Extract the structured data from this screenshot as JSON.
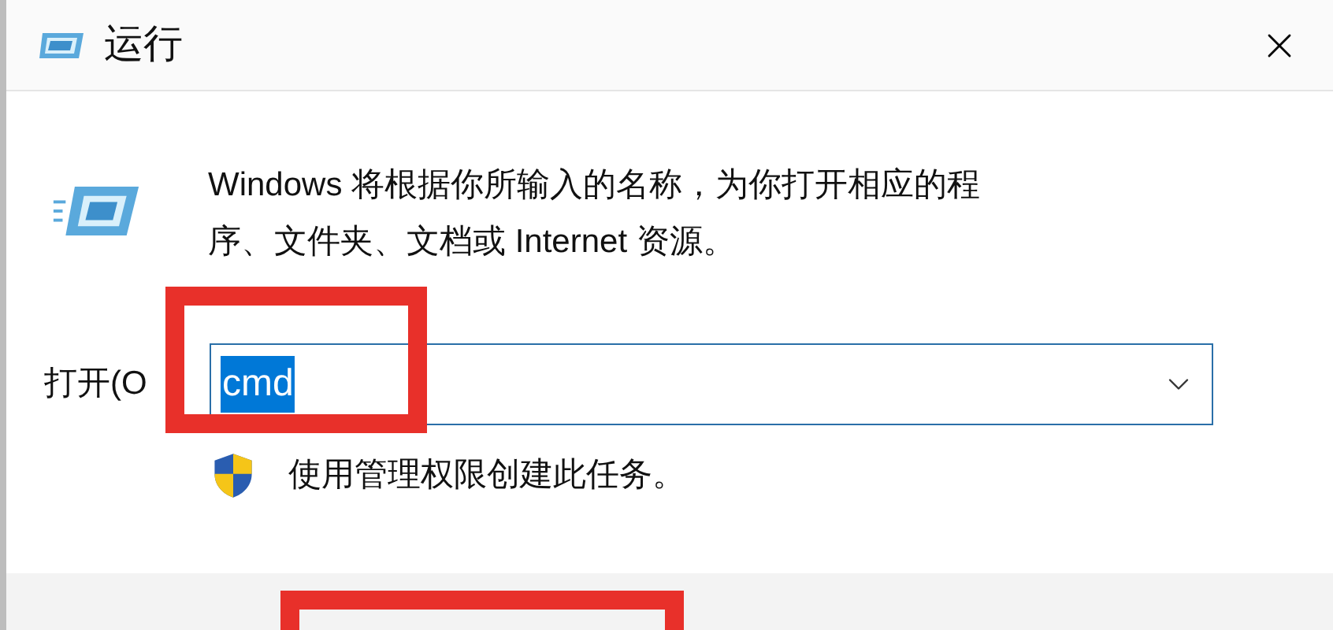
{
  "window": {
    "title": "运行"
  },
  "description": "Windows 将根据你所输入的名称，为你打开相应的程序、文件夹、文档或 Internet 资源。",
  "open_field": {
    "label": "打开(O",
    "value": "cmd",
    "value_selected": true
  },
  "admin_note": "使用管理权限创建此任务。"
}
